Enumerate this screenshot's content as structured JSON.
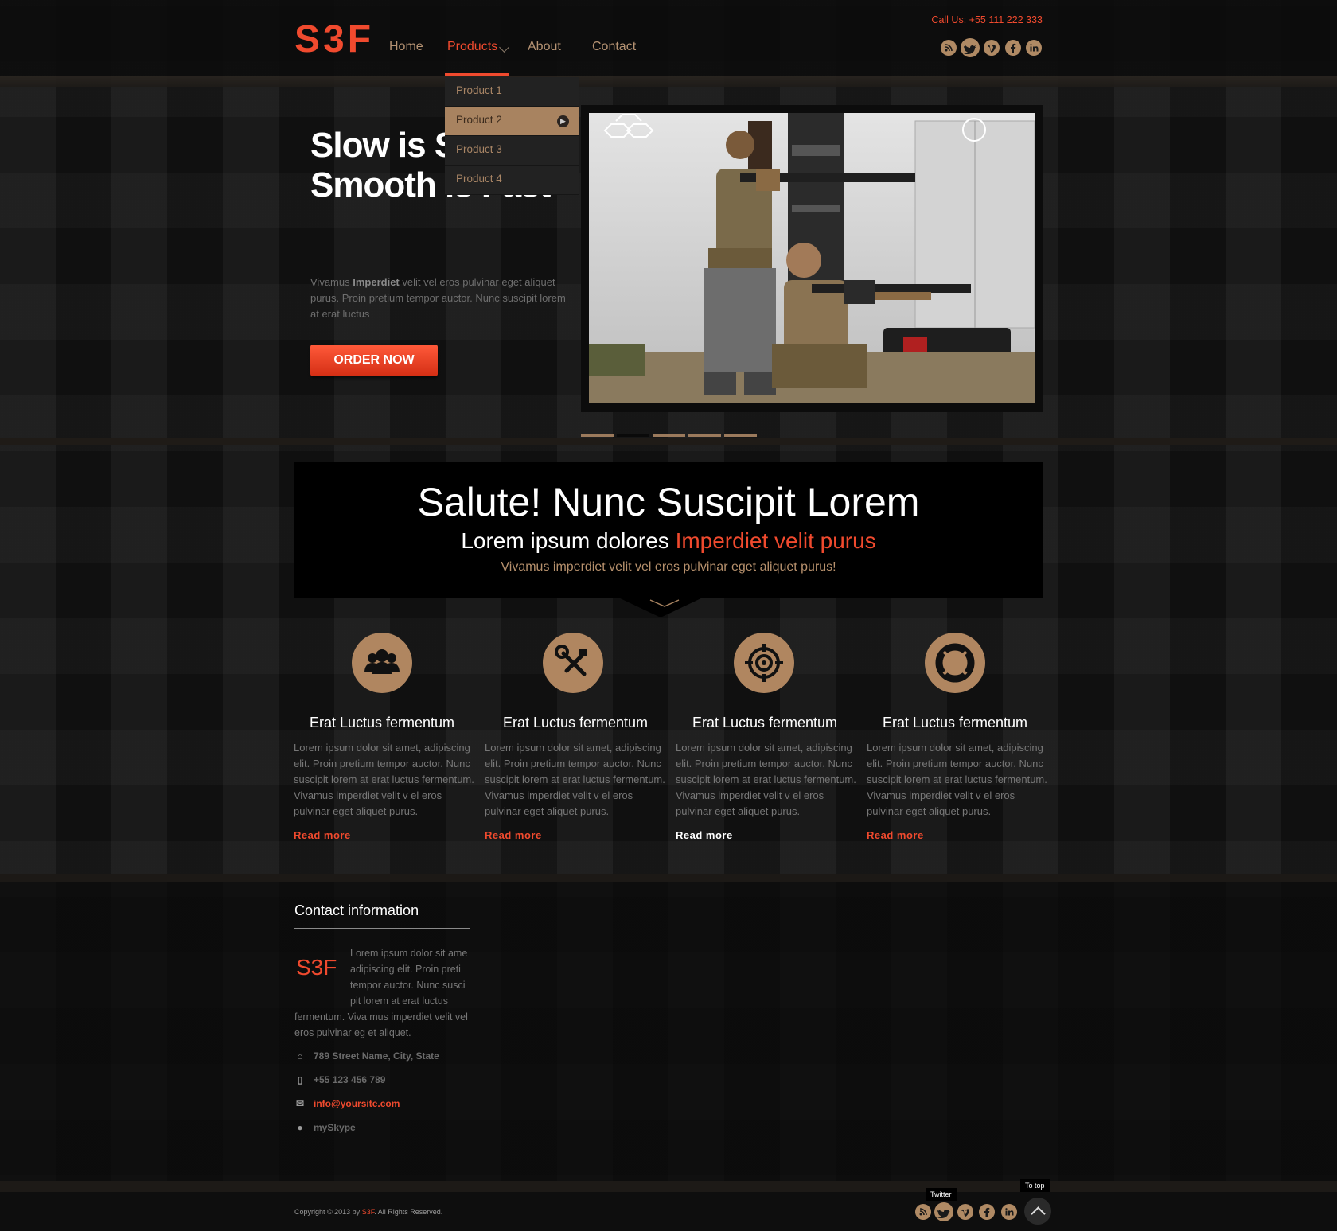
{
  "header": {
    "logo": "S3F",
    "nav": [
      "Home",
      "Products",
      "About",
      "Contact"
    ],
    "call_us": "Call Us: +55 111 222 333",
    "social": [
      "rss-icon",
      "twitter-icon",
      "vimeo-icon",
      "facebook-icon",
      "linkedin-icon"
    ]
  },
  "dropdown": [
    "Product 1",
    "Product 2",
    "Product 3",
    "Product 4"
  ],
  "hero": {
    "title_line1": "Slow is Smooth",
    "title_line2": "Smooth is Fast",
    "text_pre": "Vivamus ",
    "text_bold": "Imperdiet",
    "text_post": " velit vel eros pulvinar eget aliquet purus. Proin pretium tempor auctor. Nunc suscipit lorem at erat luctus",
    "button": "ORDER NOW",
    "slides": 5,
    "active_slide": 2
  },
  "salute": {
    "title": "Salute! Nunc Suscipit Lorem",
    "subtitle_plain": "Lorem ipsum dolores ",
    "subtitle_highlight": "Imperdiet velit purus",
    "tagline": "Vivamus imperdiet velit vel eros pulvinar eget aliquet purus!"
  },
  "features": [
    {
      "icon": "team-icon",
      "title": "Erat Luctus fermentum",
      "text": "Lorem ipsum dolor sit amet, adipiscing elit. Proin pretium tempor auctor. Nunc suscipit lorem at erat luctus fermentum. Vivamus imperdiet velit v el eros pulvinar eget aliquet purus.",
      "link": "Read more"
    },
    {
      "icon": "tools-icon",
      "title": "Erat Luctus fermentum",
      "text": "Lorem ipsum dolor sit amet, adipiscing elit. Proin pretium tempor auctor. Nunc suscipit lorem at erat luctus fermentum. Vivamus imperdiet velit v el eros pulvinar eget aliquet purus.",
      "link": "Read more"
    },
    {
      "icon": "target-icon",
      "title": "Erat Luctus fermentum",
      "text": "Lorem ipsum dolor sit amet, adipiscing elit. Proin pretium tempor auctor. Nunc suscipit lorem at erat luctus fermentum. Vivamus imperdiet velit v el eros pulvinar eget aliquet purus.",
      "link": "Read more"
    },
    {
      "icon": "lifebuoy-icon",
      "title": "Erat Luctus fermentum",
      "text": "Lorem ipsum dolor sit amet, adipiscing elit. Proin pretium tempor auctor. Nunc suscipit lorem at erat luctus fermentum. Vivamus imperdiet velit v el eros pulvinar eget aliquet purus.",
      "link": "Read more"
    }
  ],
  "contact": {
    "title": "Contact information",
    "logo": "S3F",
    "text": "Lorem ipsum dolor sit ame adipiscing elit. Proin preti tempor auctor. Nunc susci pit lorem at erat luctus fermentum. Viva mus imperdiet velit vel eros pulvinar eg et aliquet.",
    "address": "789 Street Name, City, State",
    "phone": "+55 123 456 789",
    "email": "info@yoursite.com",
    "skype": "mySkype"
  },
  "footer": {
    "copyright_pre": "Copyright © 2013 by ",
    "copyright_brand": "S3F",
    "copyright_post": ". All Rights Reserved.",
    "tooltip_twitter": "Twitter",
    "tooltip_top": "To top"
  },
  "colors": {
    "accent": "#f04a2e",
    "bronze": "#b08660",
    "background": "#151515"
  }
}
